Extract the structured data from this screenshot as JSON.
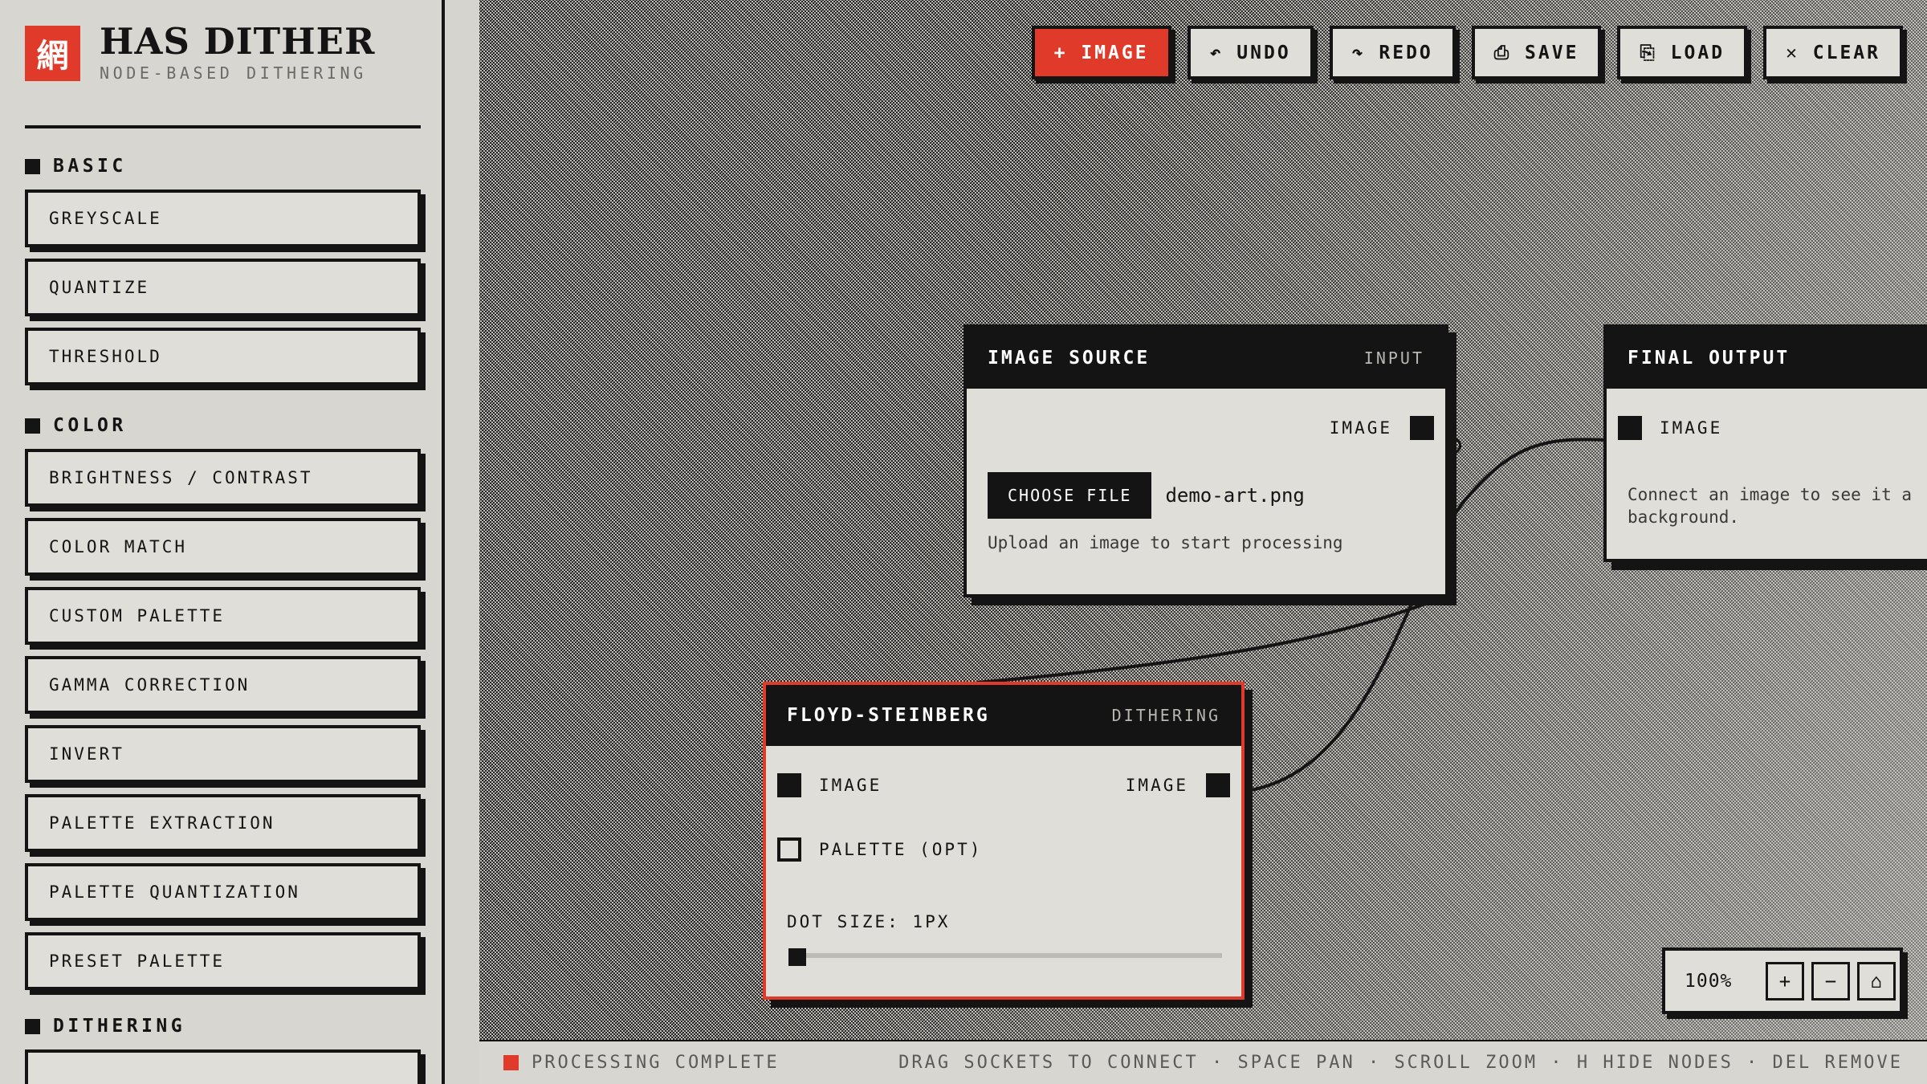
{
  "brand": {
    "logo_glyph": "網",
    "title": "HAS DITHER",
    "subtitle": "NODE-BASED DITHERING"
  },
  "sidebar": {
    "sections": [
      {
        "label": "BASIC",
        "items": [
          "GREYSCALE",
          "QUANTIZE",
          "THRESHOLD"
        ]
      },
      {
        "label": "COLOR",
        "items": [
          "BRIGHTNESS / CONTRAST",
          "COLOR MATCH",
          "CUSTOM PALETTE",
          "GAMMA CORRECTION",
          "INVERT",
          "PALETTE EXTRACTION",
          "PALETTE QUANTIZATION",
          "PRESET PALETTE"
        ]
      },
      {
        "label": "DITHERING",
        "items": []
      }
    ]
  },
  "toolbar": {
    "image": "+ IMAGE",
    "undo": "↶ UNDO",
    "redo": "↷ REDO",
    "save": "⎙ SAVE",
    "load": "⎘ LOAD",
    "clear": "✕ CLEAR"
  },
  "nodes": {
    "source": {
      "title": "IMAGE SOURCE",
      "tag": "INPUT",
      "out_label": "IMAGE",
      "choose_label": "CHOOSE FILE",
      "filename": "demo-art.png",
      "hint": "Upload an image to start processing"
    },
    "output": {
      "title": "FINAL OUTPUT",
      "in_label": "IMAGE",
      "hint": "Connect an image to see it a background."
    },
    "floyd": {
      "title": "FLOYD-STEINBERG",
      "tag": "DITHERING",
      "in_image": "IMAGE",
      "out_image": "IMAGE",
      "in_palette": "PALETTE (OPT)",
      "dot_size_label": "DOT SIZE: 1PX",
      "dot_size_value": 1
    }
  },
  "zoom": {
    "value": "100%",
    "plus": "+",
    "minus": "−",
    "home": "⌂"
  },
  "status": {
    "text": "PROCESSING COMPLETE",
    "help": "DRAG SOCKETS TO CONNECT · SPACE PAN · SCROLL ZOOM · H HIDE NODES · DEL REMOVE"
  },
  "colors": {
    "accent": "#e03a2a",
    "ink": "#141414",
    "paper": "#e0ded9"
  }
}
